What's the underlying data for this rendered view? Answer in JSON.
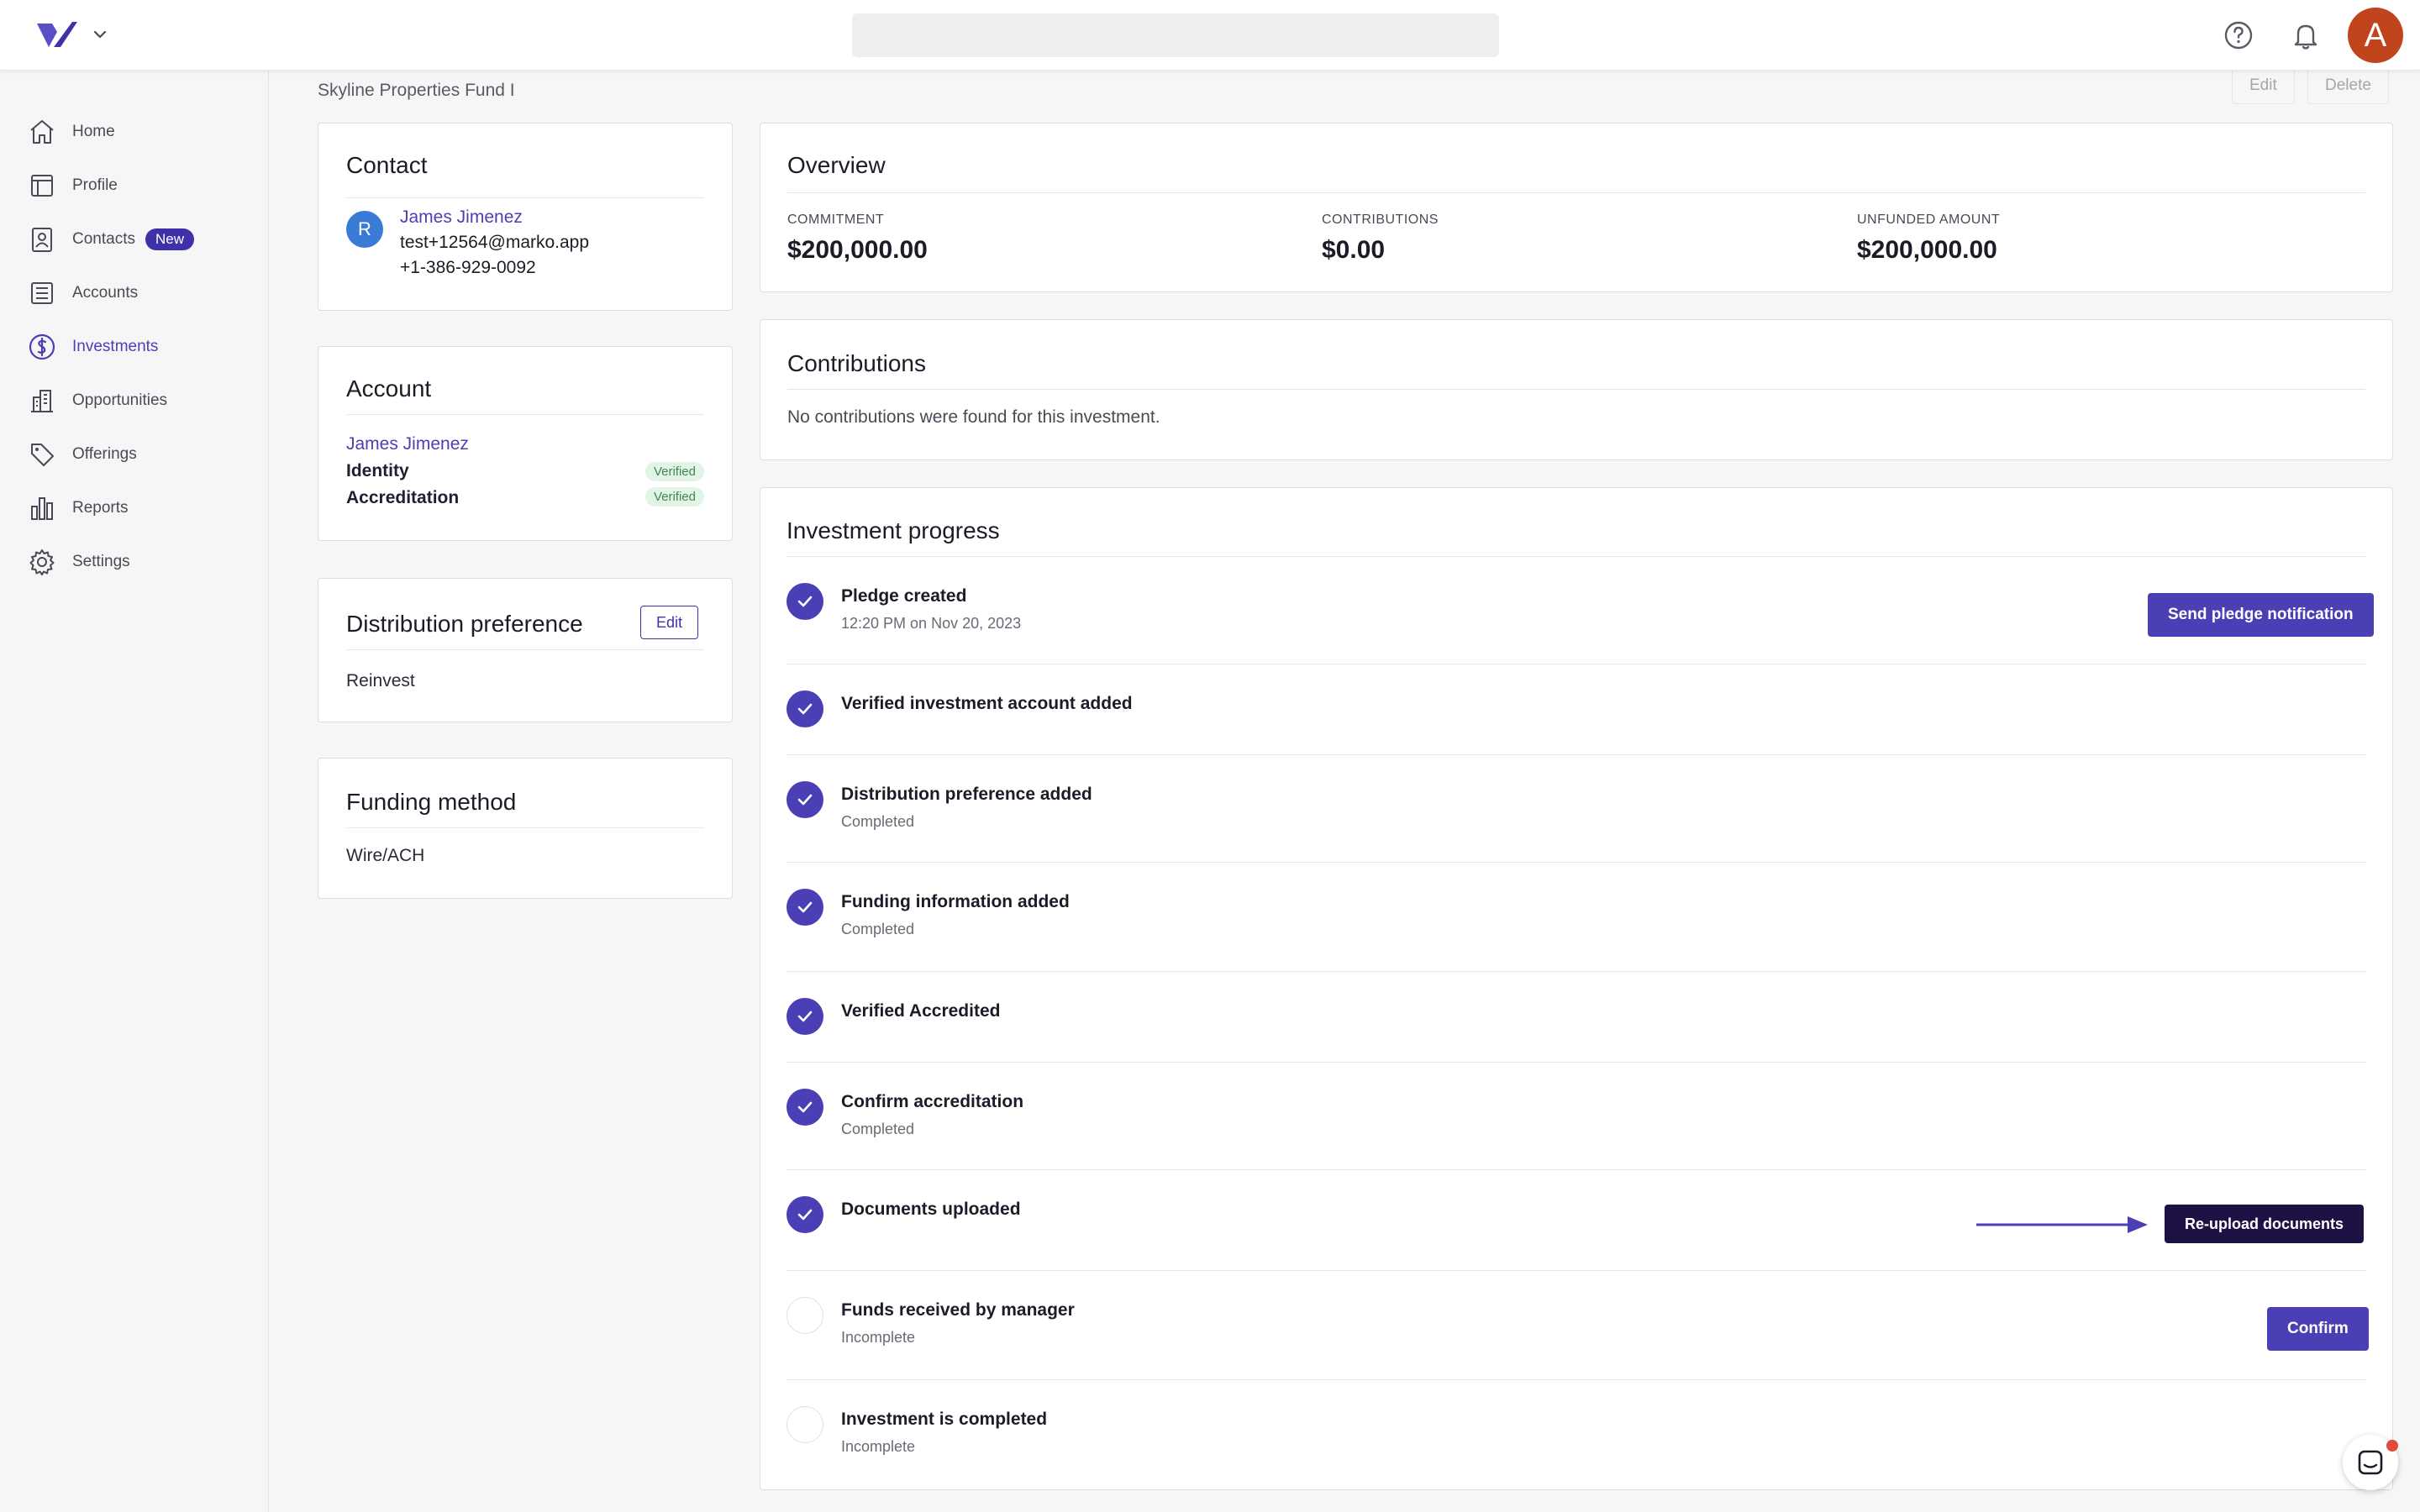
{
  "search": {
    "placeholder": ""
  },
  "avatar_initial": "A",
  "sidebar": {
    "items": [
      {
        "label": "Home",
        "icon": "home-icon"
      },
      {
        "label": "Profile",
        "icon": "profile-icon"
      },
      {
        "label": "Contacts",
        "icon": "contacts-icon",
        "badge": "New"
      },
      {
        "label": "Accounts",
        "icon": "accounts-icon"
      },
      {
        "label": "Investments",
        "icon": "investments-icon",
        "active": true
      },
      {
        "label": "Opportunities",
        "icon": "opportunities-icon"
      },
      {
        "label": "Offerings",
        "icon": "offerings-icon"
      },
      {
        "label": "Reports",
        "icon": "reports-icon"
      },
      {
        "label": "Settings",
        "icon": "settings-icon"
      }
    ]
  },
  "page": {
    "subtitle": "Skyline Properties Fund I",
    "edit_label": "Edit",
    "delete_label": "Delete"
  },
  "contact": {
    "title": "Contact",
    "avatar_initial": "R",
    "name": "James Jimenez",
    "email": "test+12564@marko.app",
    "phone": "+1-386-929-0092"
  },
  "account": {
    "title": "Account",
    "name": "James Jimenez",
    "identity_label": "Identity",
    "identity_status": "Verified",
    "accreditation_label": "Accreditation",
    "accreditation_status": "Verified"
  },
  "distribution": {
    "title": "Distribution preference",
    "edit_label": "Edit",
    "value": "Reinvest"
  },
  "funding": {
    "title": "Funding method",
    "value": "Wire/ACH"
  },
  "overview": {
    "title": "Overview",
    "commitment_label": "COMMITMENT",
    "commitment_value": "$200,000.00",
    "contributions_label": "CONTRIBUTIONS",
    "contributions_value": "$0.00",
    "unfunded_label": "UNFUNDED AMOUNT",
    "unfunded_value": "$200,000.00"
  },
  "contributions": {
    "title": "Contributions",
    "empty_text": "No contributions were found for this investment."
  },
  "progress": {
    "title": "Investment progress",
    "steps": [
      {
        "title": "Pledge created",
        "sub": "12:20 PM on Nov 20, 2023",
        "done": true,
        "action": "Send pledge notification"
      },
      {
        "title": "Verified investment account added",
        "sub": "",
        "done": true
      },
      {
        "title": "Distribution preference added",
        "sub": "Completed",
        "done": true
      },
      {
        "title": "Funding information added",
        "sub": "Completed",
        "done": true
      },
      {
        "title": "Verified Accredited",
        "sub": "",
        "done": true
      },
      {
        "title": "Confirm accreditation",
        "sub": "Completed",
        "done": true
      },
      {
        "title": "Documents uploaded",
        "sub": "",
        "done": true,
        "action": "Re-upload documents"
      },
      {
        "title": "Funds received by manager",
        "sub": "Incomplete",
        "done": false,
        "action": "Confirm"
      },
      {
        "title": "Investment is completed",
        "sub": "Incomplete",
        "done": false
      }
    ]
  },
  "colors": {
    "accent": "#4b3fb5",
    "dark_button": "#1e1244",
    "avatar": "#c0451d",
    "verified_bg": "#e2f4e6",
    "verified_text": "#3d8a4f"
  }
}
